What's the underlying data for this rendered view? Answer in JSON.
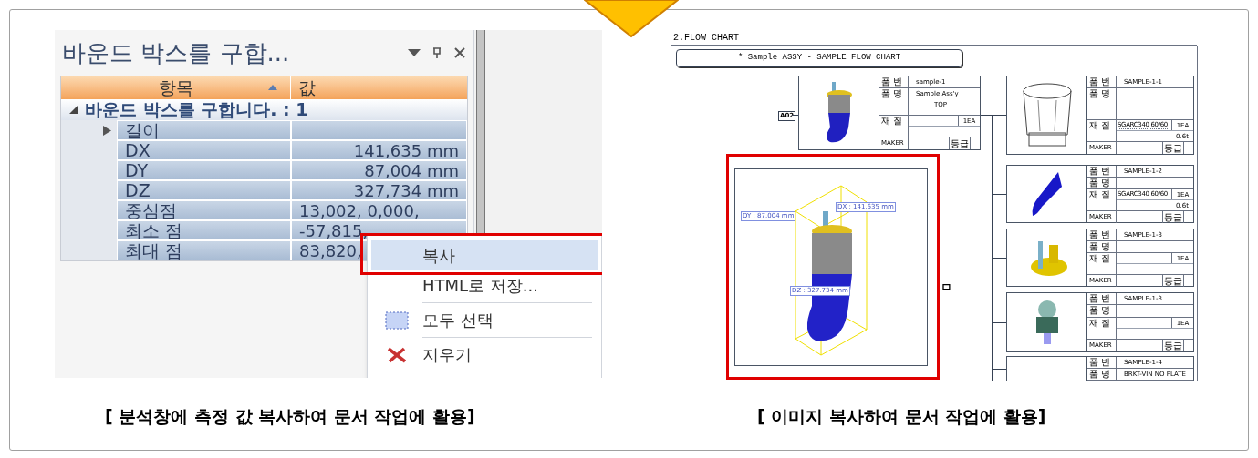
{
  "left_screen": {
    "panel": {
      "title": "바운드 박스를 구합...",
      "columns": [
        "항목",
        "값"
      ],
      "group": {
        "label": "바운드 박스를 구합니다. : 1",
        "expanded": true
      },
      "rows": [
        {
          "kind": "expandable",
          "name": "길이",
          "value": ""
        },
        {
          "kind": "measure",
          "name": "DX",
          "value": "141,635 mm"
        },
        {
          "kind": "measure",
          "name": "DY",
          "value": "87,004 mm"
        },
        {
          "kind": "measure",
          "name": "DZ",
          "value": "327,734 mm"
        },
        {
          "kind": "point",
          "name": "중심점",
          "value": "13,002, 0,000,"
        },
        {
          "kind": "point",
          "name": "최소 점",
          "value": "-57,815,"
        },
        {
          "kind": "point",
          "name": "최대 점",
          "value": "83,820,"
        }
      ]
    },
    "context_menu": {
      "items": [
        {
          "kind": "plain",
          "label": "복사",
          "selected": true
        },
        {
          "kind": "plain",
          "label": "HTML로 저장...",
          "selected": false
        },
        {
          "kind": "select-all",
          "label": "모두 선택",
          "selected": false
        },
        {
          "kind": "delete",
          "label": "지우기",
          "selected": false
        }
      ]
    }
  },
  "right_screen": {
    "heading": "2.FLOW CHART",
    "banner": "* Sample ASSY - SAMPLE FLOW CHART",
    "root_tag": "A02",
    "cards": [
      {
        "labels": [
          "품 번",
          "품 명",
          "재 질",
          "MAKER",
          "등급"
        ],
        "part_no": "sample-1",
        "name_lines": [
          "Sample Ass'y",
          "TOP"
        ],
        "qty": "1EA"
      },
      {
        "labels": [
          "품 번",
          "품 명",
          "재 질",
          "MAKER",
          "등급"
        ],
        "part_no": "SAMPLE-1-1",
        "material": "SGARC340 60/60",
        "qty": "1EA",
        "thickness": "0.6t"
      },
      {
        "labels": [
          "품 번",
          "품 명",
          "재 질",
          "MAKER",
          "등급"
        ],
        "part_no": "SAMPLE-1-2",
        "material": "SGARC340 60/60",
        "qty": "1EA",
        "thickness": "0.6t"
      },
      {
        "labels": [
          "품 번",
          "품 명",
          "재 질",
          "MAKER",
          "등급"
        ],
        "part_no": "SAMPLE-1-3",
        "qty": "1EA"
      },
      {
        "labels": [
          "품 번",
          "품 명",
          "재 질",
          "MAKER",
          "등급"
        ],
        "part_no": "SAMPLE-1-3",
        "qty": "1EA"
      },
      {
        "labels": [
          "품 번",
          "품 명"
        ],
        "part_no": "SAMPLE-1-4",
        "name_lines": [
          "BRKT-VIN NO PLATE"
        ]
      }
    ],
    "preview": {
      "dimension_labels": [
        "DY : 87.004 mm",
        "DX : 141.635 mm",
        "DZ : 327.734 mm"
      ]
    },
    "side_mark": "ㅁ"
  },
  "captions": [
    "[ 분석창에 측정 값 복사하여 문서 작업에 활용]",
    "[ 이미지 복사하여 문서 작업에 활용]"
  ]
}
